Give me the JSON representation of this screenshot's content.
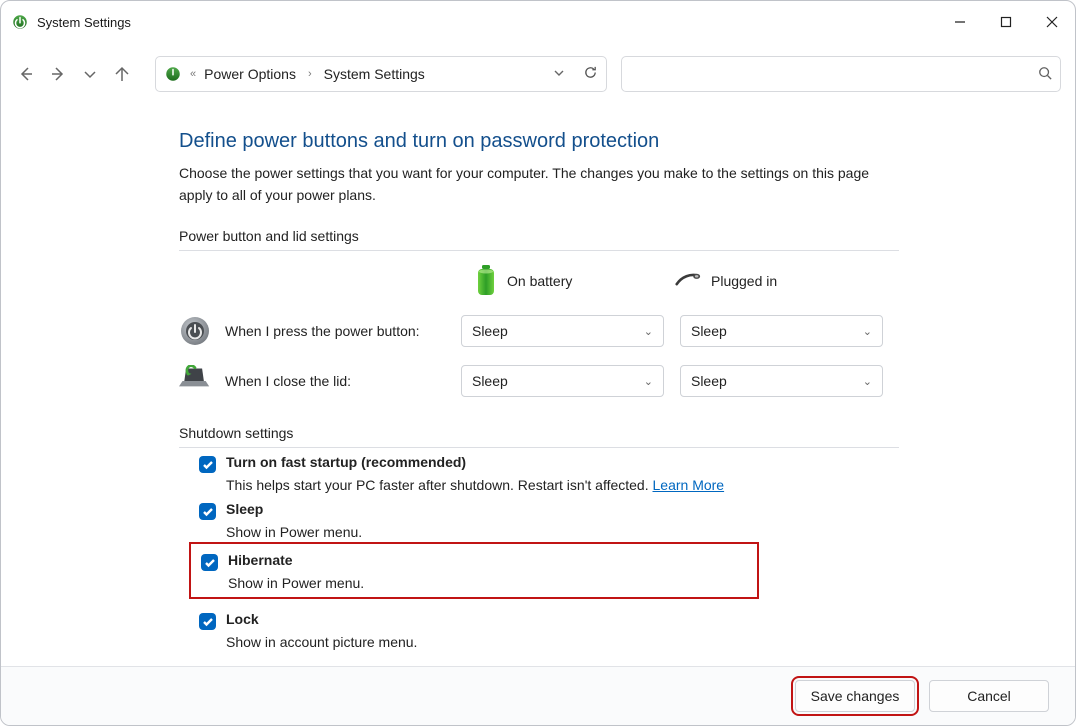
{
  "window": {
    "title": "System Settings"
  },
  "breadcrumb": {
    "items": [
      "Power Options",
      "System Settings"
    ]
  },
  "page": {
    "heading": "Define power buttons and turn on password protection",
    "description": "Choose the power settings that you want for your computer. The changes you make to the settings on this page apply to all of your power plans."
  },
  "power_section": {
    "heading": "Power button and lid settings",
    "col_battery": "On battery",
    "col_plugged": "Plugged in",
    "rows": [
      {
        "label": "When I press the power button:",
        "battery": "Sleep",
        "plugged": "Sleep"
      },
      {
        "label": "When I close the lid:",
        "battery": "Sleep",
        "plugged": "Sleep"
      }
    ]
  },
  "shutdown_section": {
    "heading": "Shutdown settings",
    "items": [
      {
        "checked": true,
        "label": "Turn on fast startup (recommended)",
        "desc": "This helps start your PC faster after shutdown. Restart isn't affected. ",
        "learn": "Learn More"
      },
      {
        "checked": true,
        "label": "Sleep",
        "desc": "Show in Power menu."
      },
      {
        "checked": true,
        "label": "Hibernate",
        "desc": "Show in Power menu."
      },
      {
        "checked": true,
        "label": "Lock",
        "desc": "Show in account picture menu."
      }
    ]
  },
  "footer": {
    "save": "Save changes",
    "cancel": "Cancel"
  }
}
